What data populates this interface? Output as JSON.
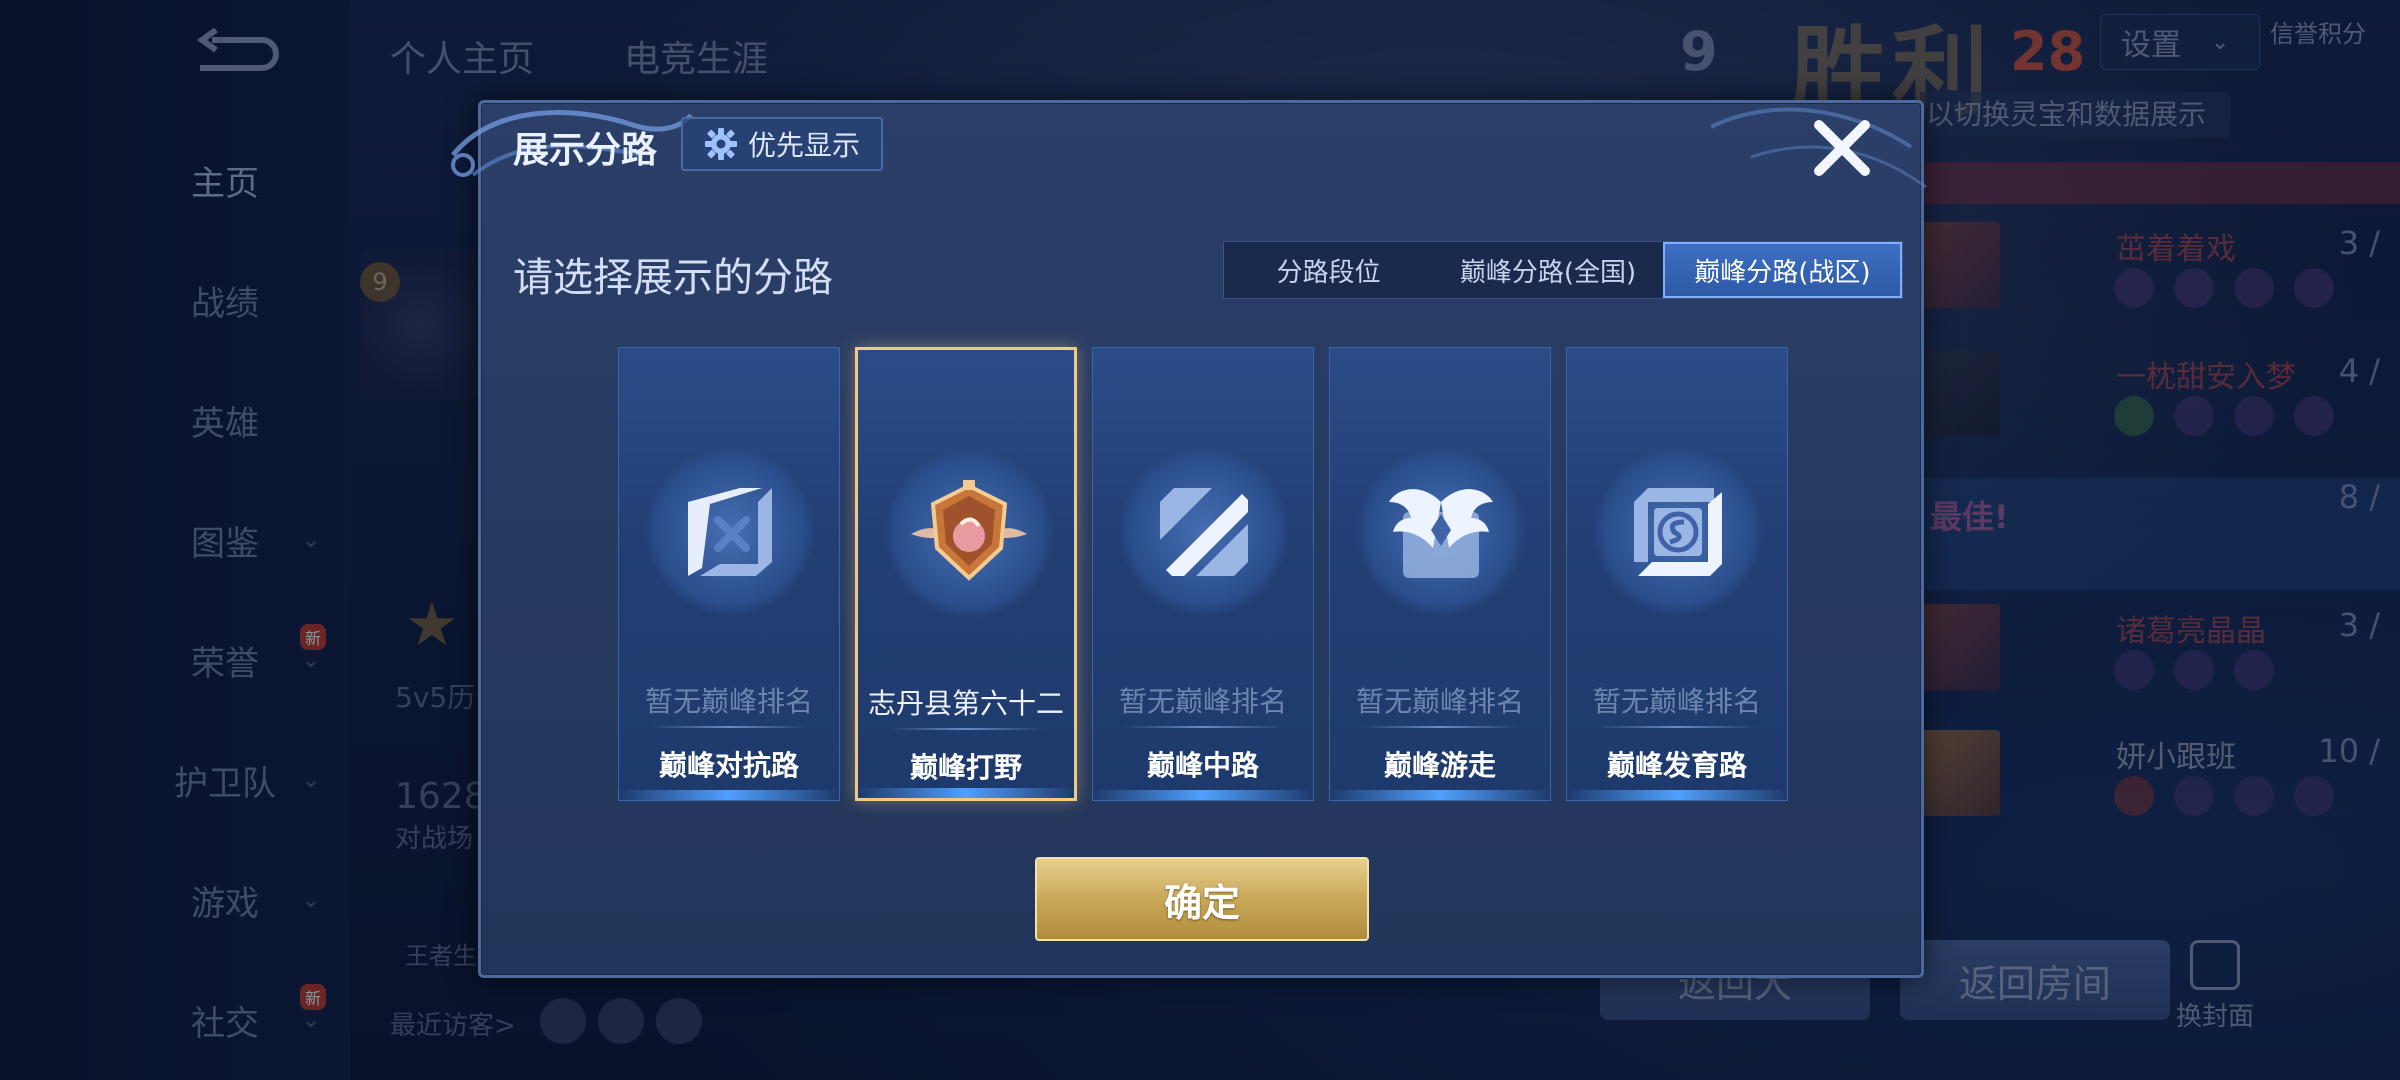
{
  "background": {
    "top_tabs": [
      "个人主页",
      "电竞生涯"
    ],
    "nav": [
      {
        "label": "主页",
        "chevron": false,
        "badge": ""
      },
      {
        "label": "战绩",
        "chevron": false,
        "badge": ""
      },
      {
        "label": "英雄",
        "chevron": false,
        "badge": ""
      },
      {
        "label": "图鉴",
        "chevron": true,
        "badge": ""
      },
      {
        "label": "荣誉",
        "chevron": true,
        "badge": "新"
      },
      {
        "label": "护卫队",
        "chevron": true,
        "badge": ""
      },
      {
        "label": "游戏",
        "chevron": true,
        "badge": ""
      },
      {
        "label": "社交",
        "chevron": true,
        "badge": "新"
      }
    ],
    "level_badge": "9",
    "profile_text_1": "5v5历",
    "profile_number": "1628",
    "profile_text_2": "对战场",
    "profile_text_3": "王者生",
    "recent_visitors": "最近访客>",
    "score_left": "9",
    "victory": "胜利",
    "score_right": "28",
    "settings_label": "设置",
    "credit_label": "信誉积分",
    "hint": "以切换灵宝和数据展示",
    "right_list": [
      {
        "name": "茁着着戏",
        "kda": "3 /"
      },
      {
        "name": "一枕甜安入梦",
        "kda": "4 /"
      },
      {
        "name": "诸葛亮晶晶",
        "kda": "3 /"
      },
      {
        "name": "妍小跟班",
        "kda": "10 /"
      }
    ],
    "mvp_text": "最佳!",
    "mvp_kda": "8 /",
    "return_room": "返回房间",
    "return_lobby": "返回大",
    "change_cover": "换封面"
  },
  "dialog": {
    "title": "展示分路",
    "priority_label": "优先显示",
    "subtitle": "请选择展示的分路",
    "segments": [
      "分路段位",
      "巅峰分路(全国)",
      "巅峰分路(战区)"
    ],
    "active_segment": "巅峰分路(战区)",
    "cards": [
      {
        "label": "巅峰对抗路",
        "rank": "暂无巅峰排名",
        "icon": "clash-lane-icon",
        "selected": false
      },
      {
        "label": "巅峰打野",
        "rank": "志丹县第六十二",
        "icon": "jungle-emblem-icon",
        "selected": true
      },
      {
        "label": "巅峰中路",
        "rank": "暂无巅峰排名",
        "icon": "mid-lane-icon",
        "selected": false
      },
      {
        "label": "巅峰游走",
        "rank": "暂无巅峰排名",
        "icon": "roam-wings-icon",
        "selected": false
      },
      {
        "label": "巅峰发育路",
        "rank": "暂无巅峰排名",
        "icon": "farm-lane-icon",
        "selected": false
      }
    ],
    "confirm_label": "确定"
  },
  "colors": {
    "accent_blue": "#3d6fc2",
    "gold": "#c9a85a",
    "selected_border": "#f0c985"
  }
}
